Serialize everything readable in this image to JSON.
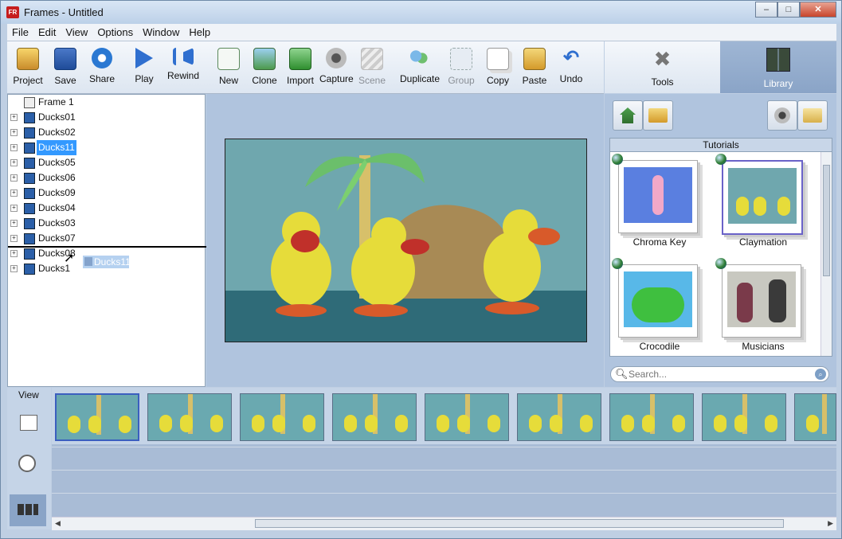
{
  "window": {
    "title": "Frames - Untitled",
    "app_icon": "FR",
    "minimize": "–",
    "maximize": "□",
    "close": "✕"
  },
  "menu": [
    "File",
    "Edit",
    "View",
    "Options",
    "Window",
    "Help"
  ],
  "toolbar": [
    {
      "label": "Project",
      "icon": "project-icon",
      "enabled": true
    },
    {
      "label": "Save",
      "icon": "save-icon",
      "enabled": true
    },
    {
      "label": "Share",
      "icon": "share-icon",
      "enabled": true
    },
    {
      "label": "Play",
      "icon": "play-icon",
      "enabled": true
    },
    {
      "label": "Rewind",
      "icon": "rewind-icon",
      "enabled": true
    },
    {
      "label": "New",
      "icon": "new-icon",
      "enabled": true
    },
    {
      "label": "Clone",
      "icon": "clone-icon",
      "enabled": true
    },
    {
      "label": "Import",
      "icon": "import-icon",
      "enabled": true
    },
    {
      "label": "Capture",
      "icon": "capture-icon",
      "enabled": true
    },
    {
      "label": "Scene",
      "icon": "scene-icon",
      "enabled": false
    },
    {
      "label": "Duplicate",
      "icon": "duplicate-icon",
      "enabled": true
    },
    {
      "label": "Group",
      "icon": "group-icon",
      "enabled": false
    },
    {
      "label": "Copy",
      "icon": "copy-icon",
      "enabled": true
    },
    {
      "label": "Paste",
      "icon": "paste-icon",
      "enabled": true
    },
    {
      "label": "Undo",
      "icon": "undo-icon",
      "enabled": true
    }
  ],
  "side_tabs": [
    {
      "label": "Tools",
      "icon": "tools-icon",
      "active": false
    },
    {
      "label": "Library",
      "icon": "library-icon",
      "active": true
    }
  ],
  "tree": {
    "items": [
      {
        "label": "Frame 1",
        "type": "frame",
        "selected": false
      },
      {
        "label": "Ducks01",
        "type": "scene",
        "selected": false
      },
      {
        "label": "Ducks02",
        "type": "scene",
        "selected": false
      },
      {
        "label": "Ducks11",
        "type": "scene",
        "selected": true
      },
      {
        "label": "Ducks05",
        "type": "scene",
        "selected": false
      },
      {
        "label": "Ducks06",
        "type": "scene",
        "selected": false
      },
      {
        "label": "Ducks09",
        "type": "scene",
        "selected": false
      },
      {
        "label": "Ducks04",
        "type": "scene",
        "selected": false
      },
      {
        "label": "Ducks03",
        "type": "scene",
        "selected": false
      },
      {
        "label": "Ducks07",
        "type": "scene",
        "selected": false
      },
      {
        "label": "Ducks08",
        "type": "scene",
        "selected": false
      },
      {
        "label": "Ducks1",
        "type": "scene",
        "selected": false
      }
    ],
    "drag_ghost": "Ducks11"
  },
  "library": {
    "section_title": "Tutorials",
    "items": [
      "Chroma Key",
      "Claymation",
      "Crocodile",
      "Musicians"
    ],
    "search_placeholder": "Search..."
  },
  "view_panel": {
    "label": "View"
  }
}
